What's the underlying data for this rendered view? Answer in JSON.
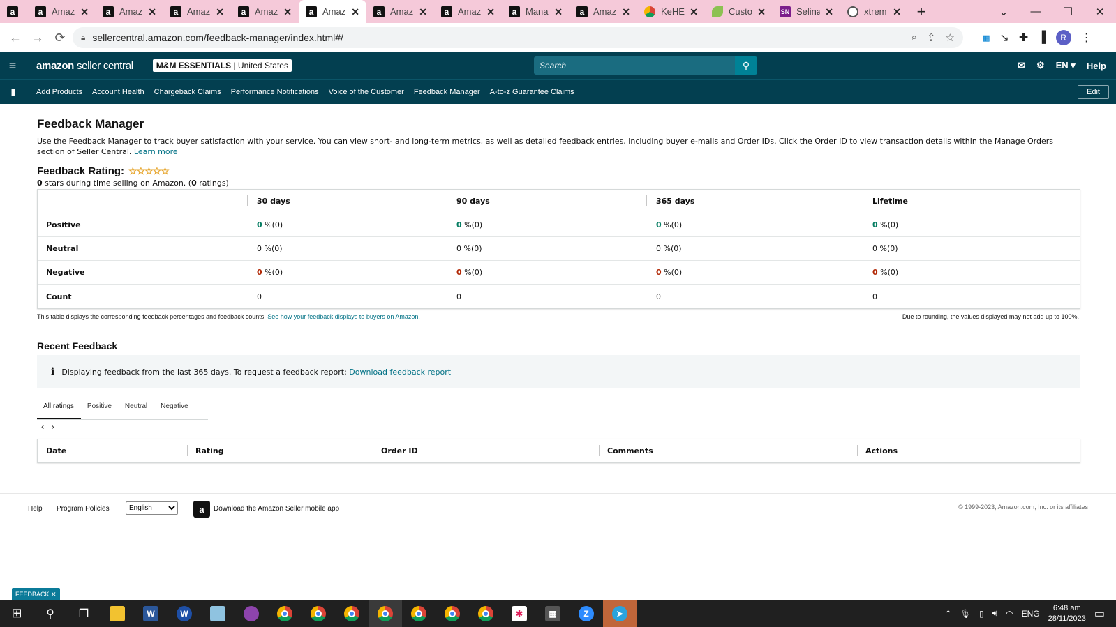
{
  "browser": {
    "tabs": [
      {
        "icon": "amazon-icon",
        "title": ""
      },
      {
        "icon": "amazon-icon",
        "title": "Amaz"
      },
      {
        "icon": "amazon-icon",
        "title": "Amaz"
      },
      {
        "icon": "amazon-icon",
        "title": "Amaz"
      },
      {
        "icon": "amazon-icon",
        "title": "Amaz"
      },
      {
        "icon": "amazon-icon",
        "title": "Amaz",
        "active": true
      },
      {
        "icon": "amazon-icon",
        "title": "Amaz"
      },
      {
        "icon": "amazon-icon",
        "title": "Amaz"
      },
      {
        "icon": "amazon-icon",
        "title": "Mana"
      },
      {
        "icon": "amazon-icon",
        "title": "Amaz"
      },
      {
        "icon": "chrome-icon",
        "title": "KeHE"
      },
      {
        "icon": "leaf-icon",
        "title": "Custo"
      },
      {
        "icon": "sn-icon",
        "title": "Selina"
      },
      {
        "icon": "globe-icon",
        "title": "xtrem"
      }
    ],
    "url": "sellercentral.amazon.com/feedback-manager/index.html#/",
    "profile_initial": "R"
  },
  "header": {
    "logo_brand": "amazon",
    "logo_product": "seller central",
    "store_name": "M&M ESSENTIALS",
    "store_region": "United States",
    "search_placeholder": "Search",
    "language": "EN",
    "help": "Help"
  },
  "nav": {
    "links": [
      "Add Products",
      "Account Health",
      "Chargeback Claims",
      "Performance Notifications",
      "Voice of the Customer",
      "Feedback Manager",
      "A-to-z Guarantee Claims"
    ],
    "edit": "Edit"
  },
  "page": {
    "title": "Feedback Manager",
    "intro": "Use the Feedback Manager to track buyer satisfaction with your service. You can view short- and long-term metrics, as well as detailed feedback entries, including buyer e-mails and Order IDs. Click the Order ID to view transaction details within the Manage Orders section of Seller Central.",
    "learn_more": "Learn more",
    "rating_label": "Feedback Rating:",
    "stars": "☆☆☆☆☆",
    "rating_sub_count": "0",
    "rating_sub_text": " stars during time selling on Amazon. (",
    "rating_sub_ratings": "0",
    "rating_sub_end": " ratings)"
  },
  "feedback_table": {
    "columns": [
      "",
      "30 days",
      "90 days",
      "365 days",
      "Lifetime"
    ],
    "rows": [
      {
        "label": "Positive",
        "value": "0",
        "rest": " %(0)",
        "tone": "g"
      },
      {
        "label": "Neutral",
        "value": "0",
        "rest": " %(0)",
        "tone": ""
      },
      {
        "label": "Negative",
        "value": "0",
        "rest": " %(0)",
        "tone": "r"
      },
      {
        "label": "Count",
        "value": "0",
        "rest": "",
        "tone": ""
      }
    ],
    "note_left": "This table displays the corresponding feedback percentages and feedback counts.",
    "note_link": "See how your feedback displays to buyers on Amazon.",
    "note_right": "Due to rounding, the values displayed may not add up to 100%."
  },
  "recent": {
    "title": "Recent Feedback",
    "info_text": "Displaying feedback from the last 365 days. To request a feedback report:",
    "info_link": "Download feedback report",
    "tabs": [
      "All ratings",
      "Positive",
      "Neutral",
      "Negative"
    ],
    "columns": [
      "Date",
      "Rating",
      "Order ID",
      "Comments",
      "Actions"
    ]
  },
  "footer": {
    "help": "Help",
    "program_policies": "Program Policies",
    "language": "English",
    "app_download": "Download the Amazon Seller mobile app",
    "copyright": "© 1999-2023, Amazon.com, Inc. or its affiliates"
  },
  "feedback_badge": "FEEDBACK ✕",
  "taskbar": {
    "lang": "ENG",
    "time": "6:48 am",
    "date": "28/11/2023"
  },
  "colors": {
    "brand_dark": "#033f50",
    "link": "#007185",
    "positive": "#067d62",
    "negative": "#b12704",
    "tab_strip": "#f5c9d9"
  }
}
